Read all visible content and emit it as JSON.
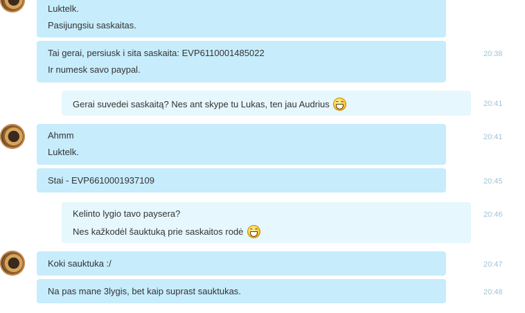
{
  "messages": [
    {
      "type": "in",
      "lines": [
        "Luktelk.",
        "Pasijungsiu saskaitas."
      ],
      "time": ""
    },
    {
      "type": "in",
      "lines": [
        "Tai gerai, persiusk i sita saskaita: EVP6110001485022",
        "Ir numesk savo paypal."
      ],
      "time": "20:38"
    },
    {
      "type": "out",
      "lines": [
        "Gerai suvedei saskaitą? Nes ant skype tu Lukas, ten jau Audrius"
      ],
      "time": "20:41"
    },
    {
      "type": "in",
      "lines": [
        "Ahmm",
        "Luktelk."
      ],
      "time": "20:41"
    },
    {
      "type": "in",
      "lines": [
        "Stai - EVP6610001937109"
      ],
      "time": "20:45"
    },
    {
      "type": "out",
      "lines": [
        "Kelinto lygio tavo paysera?",
        "Nes kažkodėl šauktuką prie saskaitos rodė"
      ],
      "time": "20:46"
    },
    {
      "type": "in",
      "lines": [
        "Koki sauktuka :/"
      ],
      "time": "20:47"
    },
    {
      "type": "in",
      "lines": [
        "Na pas mane 3lygis, bet kaip suprast sauktukas."
      ],
      "time": "20:48"
    }
  ],
  "emoji_name": "grinning-emoji"
}
